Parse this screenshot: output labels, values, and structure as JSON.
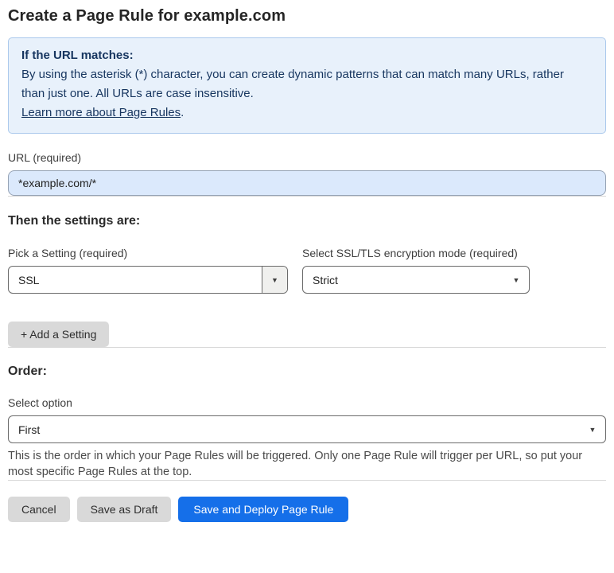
{
  "page": {
    "title": "Create a Page Rule for example.com"
  },
  "info_box": {
    "heading": "If the URL matches:",
    "body": "By using the asterisk (*) character, you can create dynamic patterns that can match many URLs, rather than just one. All URLs are case insensitive.",
    "link_label": "Learn more about Page Rules",
    "link_suffix": "."
  },
  "url_field": {
    "label": "URL (required)",
    "value": "*example.com/*"
  },
  "settings_section": {
    "heading": "Then the settings are:",
    "setting_select": {
      "label": "Pick a Setting (required)",
      "value": "SSL"
    },
    "mode_select": {
      "label": "Select SSL/TLS encryption mode (required)",
      "value": "Strict"
    },
    "add_setting_label": "+ Add a Setting"
  },
  "order_section": {
    "heading": "Order:",
    "select_label": "Select option",
    "select_value": "First",
    "help_text": "This is the order in which your Page Rules will be triggered. Only one Page Rule will trigger per URL, so put your most specific Page Rules at the top."
  },
  "footer": {
    "cancel_label": "Cancel",
    "save_draft_label": "Save as Draft",
    "save_deploy_label": "Save and Deploy Page Rule"
  },
  "icons": {
    "chevron_down": "▼"
  },
  "colors": {
    "accent_blue": "#156fe9",
    "info_box_bg": "#e8f1fb",
    "info_box_border": "#abc9ec",
    "info_box_text": "#16355f",
    "url_input_bg": "#dbe9fc",
    "url_input_border": "#96a3b5",
    "gray_button_bg": "#d9d9d9",
    "select_border": "#6b6b6b",
    "divider": "#d8d8d8"
  }
}
